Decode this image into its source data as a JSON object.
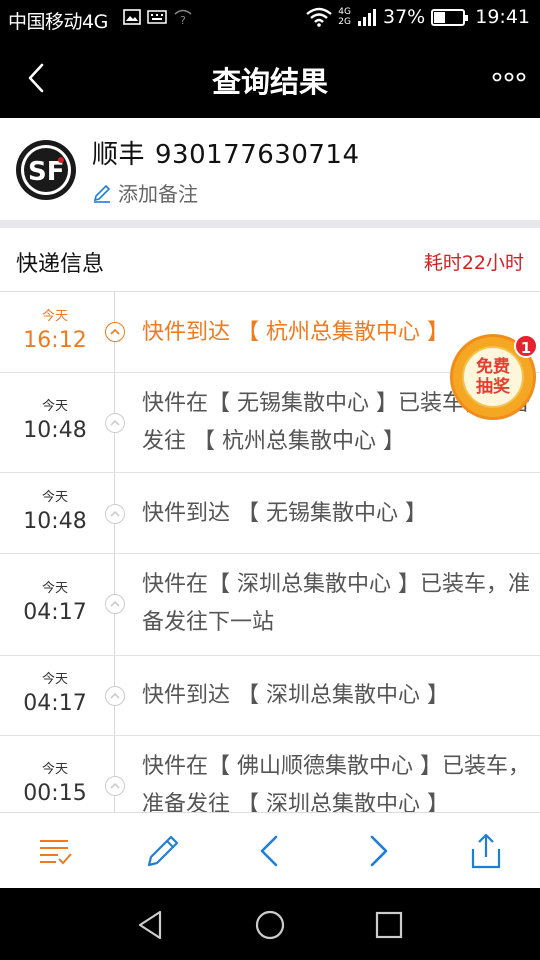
{
  "status_bar": {
    "carrier": "中国移动4G",
    "network_top": "4G",
    "network_bottom": "2G",
    "battery": "37%",
    "battery_level": 0.37,
    "time": "19:41"
  },
  "header": {
    "title": "查询结果",
    "back_icon": "back-arrow-icon",
    "more_icon": "more-dots-icon"
  },
  "package": {
    "courier": "顺丰",
    "tracking_number": "930177630714",
    "note_label": "添加备注",
    "logo_icon": "sf-express-logo"
  },
  "section": {
    "label": "快递信息",
    "elapsed": "耗时22小时"
  },
  "timeline": [
    {
      "day": "今天",
      "clock": "16:12",
      "text": "快件到达 【 杭州总集散中心 】",
      "active": true
    },
    {
      "day": "今天",
      "clock": "10:48",
      "text": "快件在【 无锡集散中心 】已装车，准备发往 【 杭州总集散中心 】",
      "active": false
    },
    {
      "day": "今天",
      "clock": "10:48",
      "text": "快件到达 【 无锡集散中心 】",
      "active": false
    },
    {
      "day": "今天",
      "clock": "04:17",
      "text": "快件在【 深圳总集散中心 】已装车，准备发往下一站",
      "active": false
    },
    {
      "day": "今天",
      "clock": "04:17",
      "text": "快件到达 【 深圳总集散中心 】",
      "active": false
    },
    {
      "day": "今天",
      "clock": "00:15",
      "text": "快件在【 佛山顺德集散中心 】已装车，准备发往 【 深圳总集散中心 】",
      "active": false
    }
  ],
  "lottery": {
    "line1": "免费",
    "line2": "抽奖",
    "count": "1"
  },
  "toolbar": {
    "icons": [
      "list-check-icon",
      "edit-pencil-icon",
      "prev-arrow-icon",
      "next-arrow-icon",
      "share-icon"
    ],
    "accent": "#f07b1e",
    "blue": "#1e7fd8"
  },
  "navbar": {
    "icons": [
      "nav-back-triangle-icon",
      "nav-home-circle-icon",
      "nav-recents-square-icon"
    ]
  }
}
